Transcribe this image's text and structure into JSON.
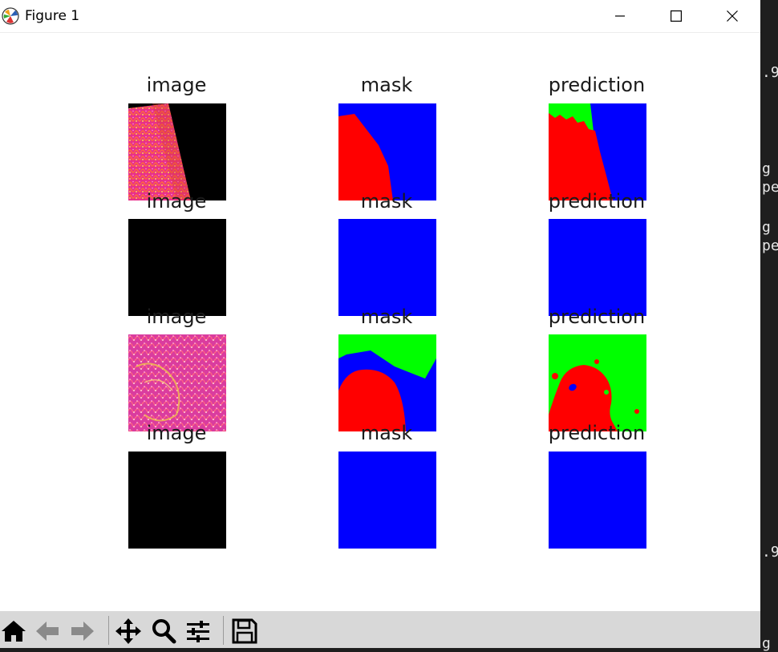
{
  "window": {
    "title": "Figure 1",
    "icons": {
      "app": "matplotlib-icon",
      "minimize": "minimize-icon",
      "maximize": "maximize-icon",
      "close": "close-icon"
    }
  },
  "figure": {
    "rows": [
      {
        "image": "image",
        "mask": "mask",
        "prediction": "prediction"
      },
      {
        "image": "image",
        "mask": "mask",
        "prediction": "prediction"
      },
      {
        "image": "image",
        "mask": "mask",
        "prediction": "prediction"
      },
      {
        "image": "image",
        "mask": "mask",
        "prediction": "prediction"
      }
    ],
    "colors": {
      "red": "#ff0000",
      "green": "#00ff00",
      "blue": "#0000ff",
      "black": "#000000",
      "tissue": "#e8308a"
    }
  },
  "toolbar": {
    "icons": [
      "home-icon",
      "back-arrow-icon",
      "forward-arrow-icon",
      "pan-icon",
      "zoom-icon",
      "configure-subplots-icon",
      "save-icon"
    ]
  },
  "terminal": {
    "lines": [
      ".9",
      "g",
      "pe",
      "g",
      "pe",
      ".9",
      "g"
    ]
  }
}
